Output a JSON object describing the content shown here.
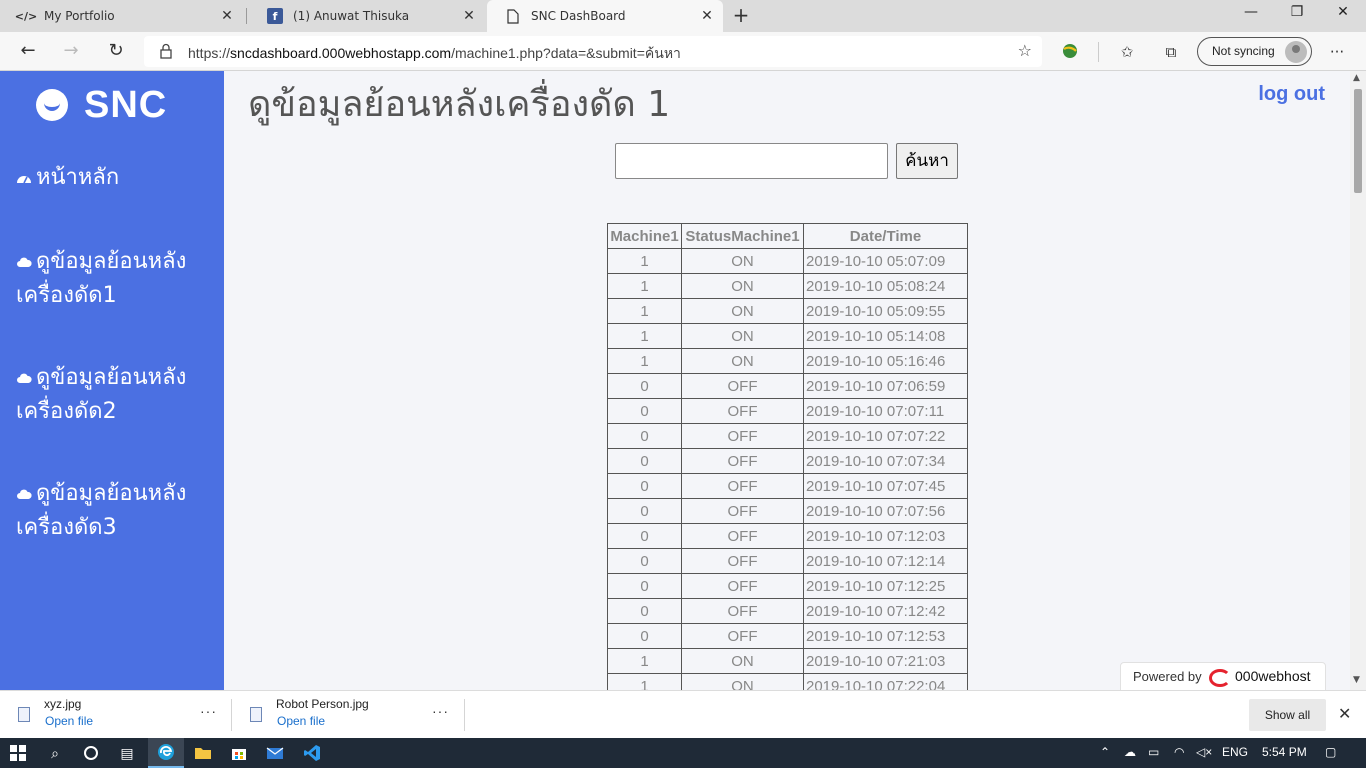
{
  "browser": {
    "tabs": [
      {
        "label": "My Portfolio",
        "icon": "code-icon",
        "active": false
      },
      {
        "label": "(1) Anuwat Thisuka",
        "icon": "facebook-icon",
        "active": false
      },
      {
        "label": "SNC DashBoard",
        "icon": "page-icon",
        "active": true
      }
    ],
    "url": {
      "prefix": "https://",
      "host": "sncdashboard.000webhostapp.com",
      "path": "/machine1.php?data=&submit=ค้นหา"
    },
    "sync_label": "Not syncing",
    "new_tab_symbol": "+",
    "more_symbol": "···"
  },
  "sidebar": {
    "brand": "SNC",
    "items": [
      {
        "label": "หน้าหลัก",
        "icon": "dashboard-icon"
      },
      {
        "label": "ดูข้อมูลย้อนหลังเครื่องดัด1",
        "icon": "cloud-icon"
      },
      {
        "label": "ดูข้อมูลย้อนหลังเครื่องดัด2",
        "icon": "cloud-icon"
      },
      {
        "label": "ดูข้อมูลย้อนหลังเครื่องดัด3",
        "icon": "cloud-icon"
      }
    ],
    "color": "#4b70e2"
  },
  "main": {
    "title": "ดูข้อมูลย้อนหลังเครื่องดัด 1",
    "logout_label": "log out",
    "search": {
      "value": "",
      "button_label": "ค้นหา"
    },
    "table": {
      "headers": [
        "Machine1",
        "StatusMachine1",
        "Date/Time"
      ],
      "rows": [
        [
          "1",
          "ON",
          "2019-10-10 05:07:09"
        ],
        [
          "1",
          "ON",
          "2019-10-10 05:08:24"
        ],
        [
          "1",
          "ON",
          "2019-10-10 05:09:55"
        ],
        [
          "1",
          "ON",
          "2019-10-10 05:14:08"
        ],
        [
          "1",
          "ON",
          "2019-10-10 05:16:46"
        ],
        [
          "0",
          "OFF",
          "2019-10-10 07:06:59"
        ],
        [
          "0",
          "OFF",
          "2019-10-10 07:07:11"
        ],
        [
          "0",
          "OFF",
          "2019-10-10 07:07:22"
        ],
        [
          "0",
          "OFF",
          "2019-10-10 07:07:34"
        ],
        [
          "0",
          "OFF",
          "2019-10-10 07:07:45"
        ],
        [
          "0",
          "OFF",
          "2019-10-10 07:07:56"
        ],
        [
          "0",
          "OFF",
          "2019-10-10 07:12:03"
        ],
        [
          "0",
          "OFF",
          "2019-10-10 07:12:14"
        ],
        [
          "0",
          "OFF",
          "2019-10-10 07:12:25"
        ],
        [
          "0",
          "OFF",
          "2019-10-10 07:12:42"
        ],
        [
          "0",
          "OFF",
          "2019-10-10 07:12:53"
        ],
        [
          "1",
          "ON",
          "2019-10-10 07:21:03"
        ],
        [
          "1",
          "ON",
          "2019-10-10 07:22:04"
        ]
      ]
    },
    "powered_by": {
      "label": "Powered by",
      "name": "000webhost"
    }
  },
  "downloads": {
    "items": [
      {
        "name": "xyz.jpg",
        "action": "Open file"
      },
      {
        "name": "Robot Person.jpg",
        "action": "Open file"
      }
    ],
    "show_all_label": "Show all"
  },
  "taskbar": {
    "language": "ENG",
    "time": "5:54 PM"
  }
}
